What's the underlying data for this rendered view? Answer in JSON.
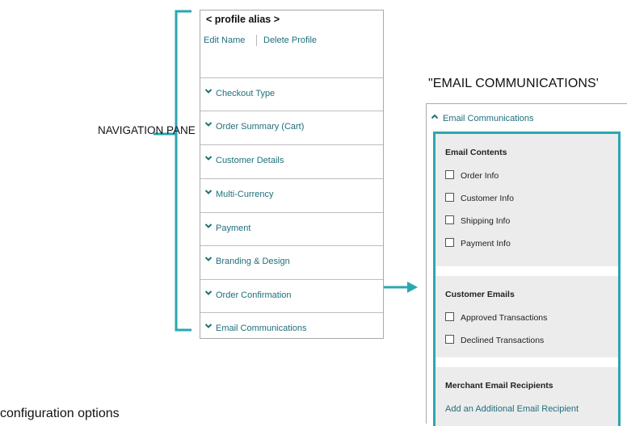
{
  "annotations": {
    "nav_pane_label": "NAVIGATION PANE",
    "email_section_title": "\"EMAIL COMMUNICATIONS'",
    "bottom_caption": "configuration options",
    "annotation_color": "#2aa7b2"
  },
  "nav_pane": {
    "alias": "< profile alias >",
    "edit_name": "Edit Name",
    "delete_profile": "Delete Profile",
    "items": [
      {
        "label": "Checkout Type",
        "icon": "chevron-down-icon"
      },
      {
        "label": "Order Summary (Cart)",
        "icon": "chevron-down-icon"
      },
      {
        "label": "Customer Details",
        "icon": "chevron-down-icon"
      },
      {
        "label": "Multi-Currency",
        "icon": "chevron-down-icon"
      },
      {
        "label": "Payment",
        "icon": "chevron-down-icon"
      },
      {
        "label": "Branding & Design",
        "icon": "chevron-down-icon"
      },
      {
        "label": "Order Confirmation",
        "icon": "chevron-down-icon"
      },
      {
        "label": "Email Communications",
        "icon": "chevron-down-icon"
      }
    ]
  },
  "email_panel": {
    "header": {
      "label": "Email Communications",
      "icon": "chevron-up-icon"
    },
    "sections": [
      {
        "title": "Email Contents",
        "options": [
          {
            "label": "Order Info",
            "checked": false
          },
          {
            "label": "Customer Info",
            "checked": false
          },
          {
            "label": "Shipping Info",
            "checked": false
          },
          {
            "label": "Payment Info",
            "checked": false
          }
        ]
      },
      {
        "title": "Customer Emails",
        "options": [
          {
            "label": "Approved Transactions",
            "checked": false
          },
          {
            "label": "Declined Transactions",
            "checked": false
          }
        ]
      },
      {
        "title": "Merchant Email Recipients",
        "link": "Add an Additional Email Recipient"
      }
    ]
  },
  "colors": {
    "link": "#1f6f7a",
    "accent": "#2aa7b2",
    "section_bg": "#ececec"
  }
}
